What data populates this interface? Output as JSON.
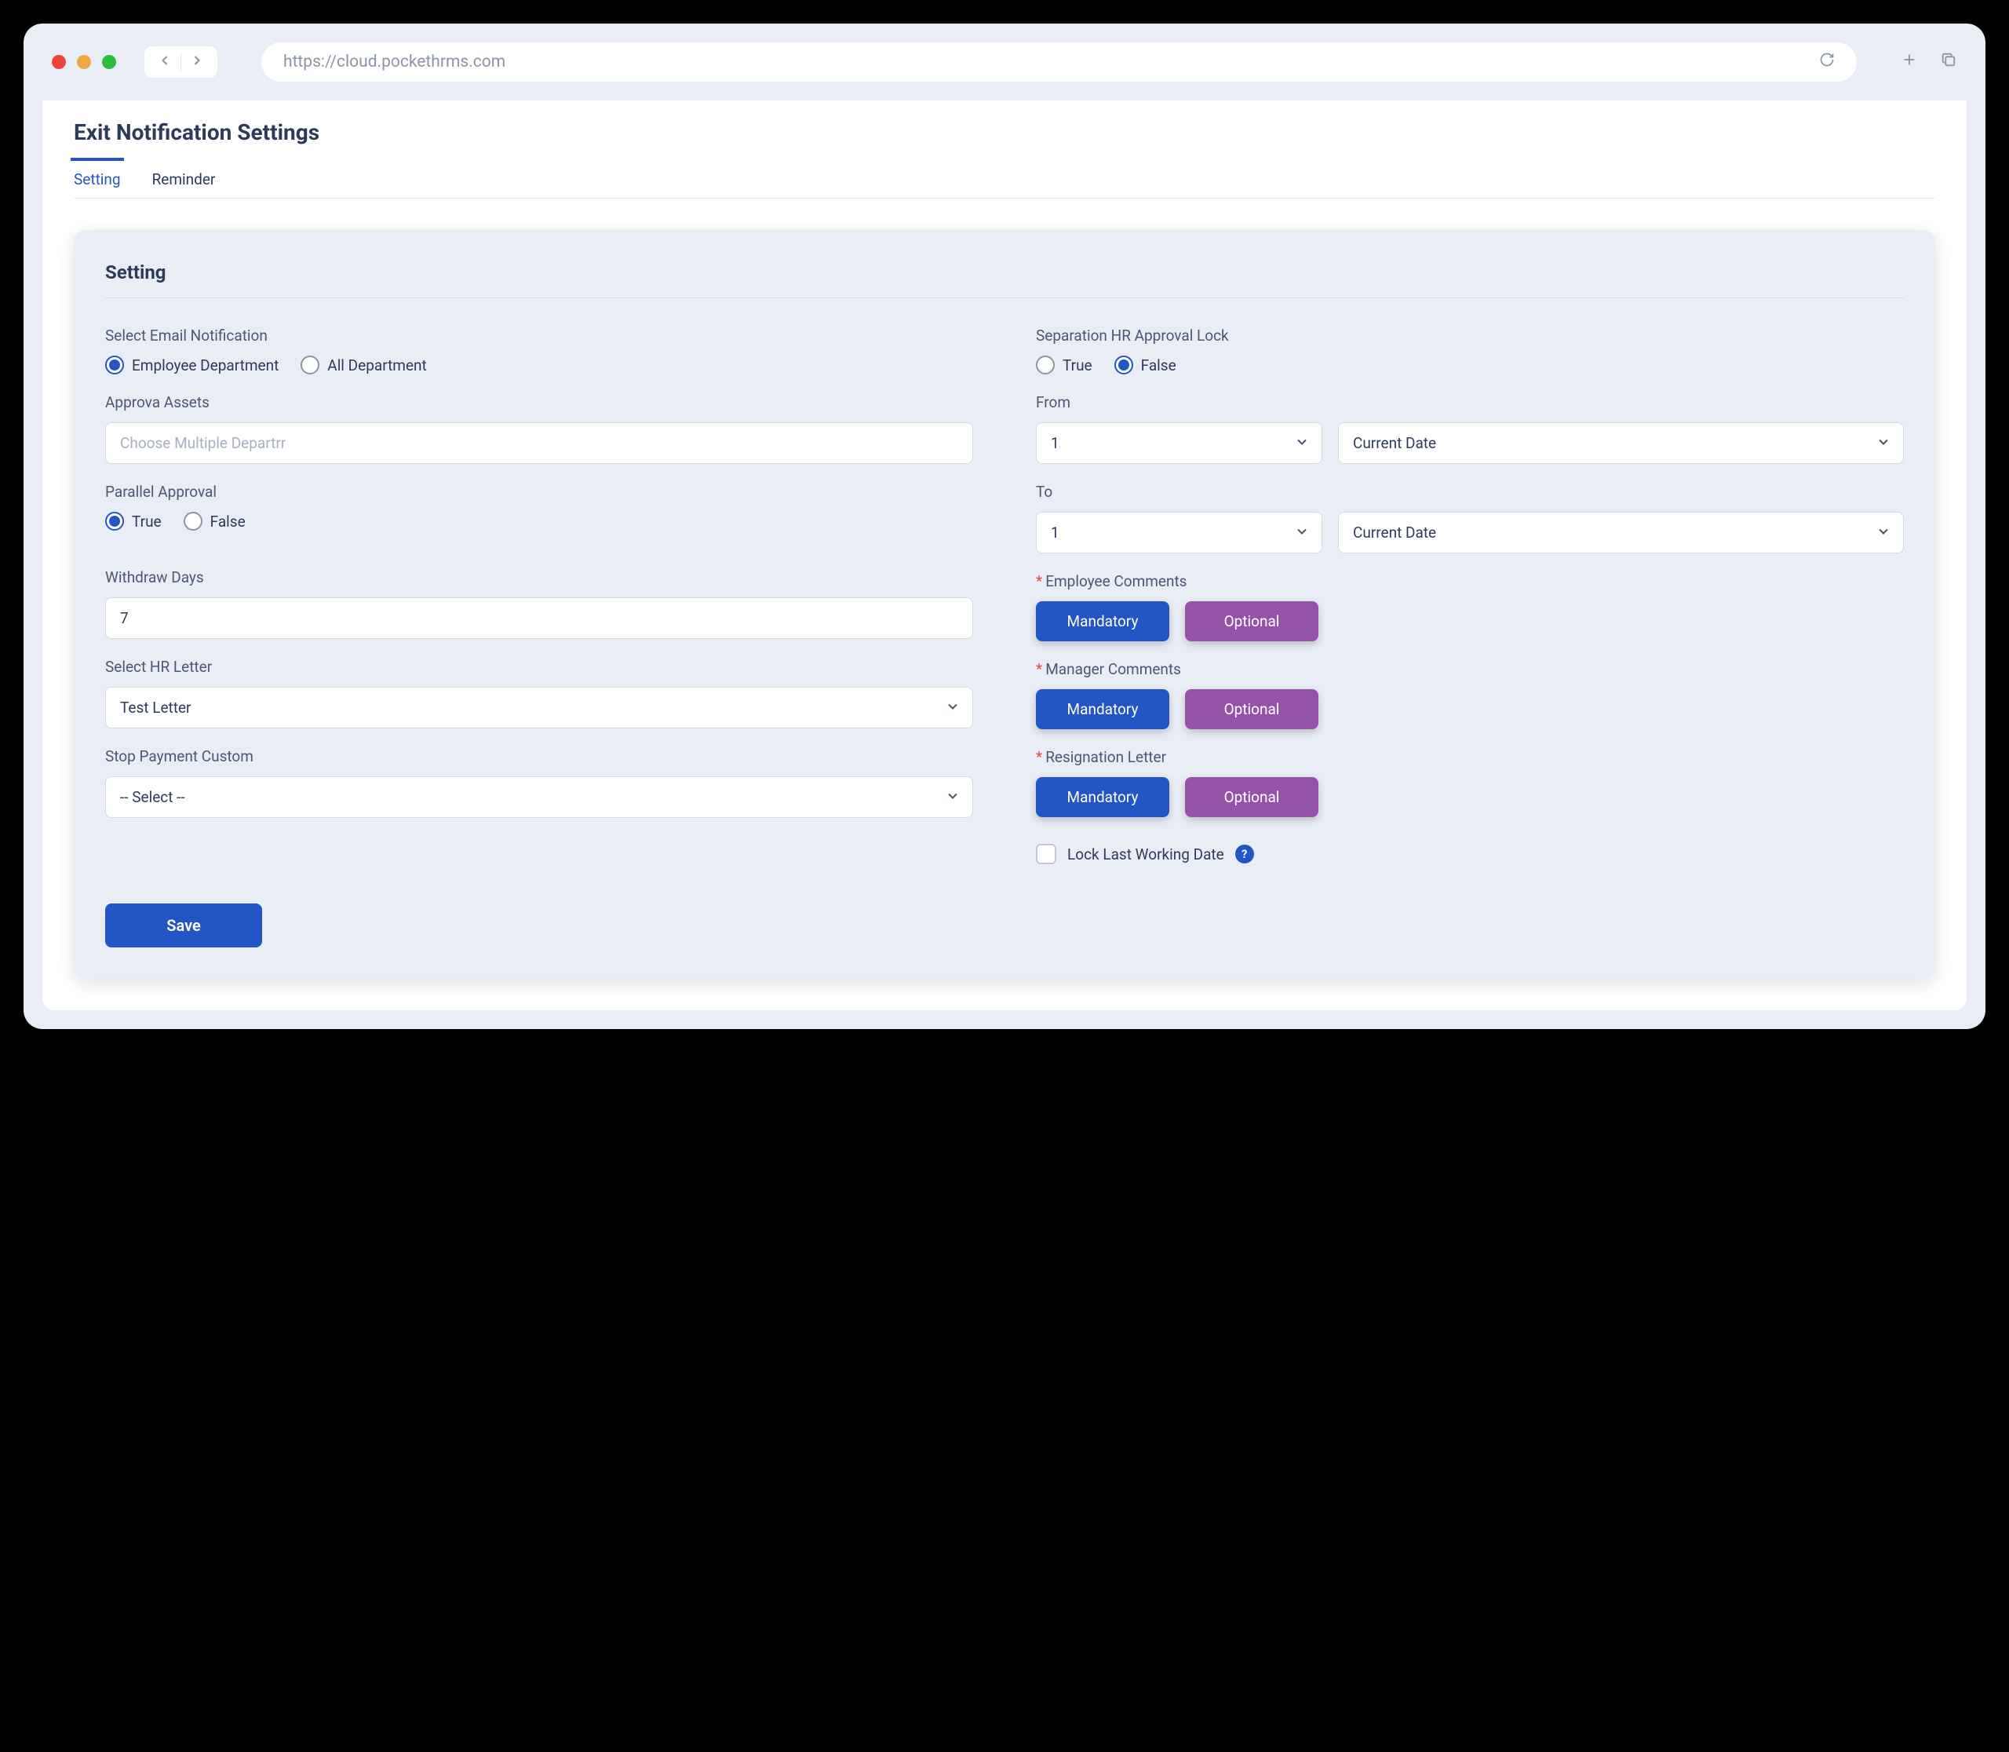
{
  "browser": {
    "url": "https://cloud.pockethrms.com"
  },
  "page": {
    "title": "Exit Notification Settings"
  },
  "tabs": {
    "setting": "Setting",
    "reminder": "Reminder"
  },
  "card": {
    "title": "Setting"
  },
  "left": {
    "emailNotification": {
      "label": "Select Email Notification",
      "opt1": "Employee Department",
      "opt2": "All Department"
    },
    "approvaAssets": {
      "label": "Approva Assets",
      "placeholder": "Choose Multiple Departrr"
    },
    "parallelApproval": {
      "label": "Parallel Approval",
      "opt1": "True",
      "opt2": "False"
    },
    "withdrawDays": {
      "label": "Withdraw Days",
      "value": "7"
    },
    "hrLetter": {
      "label": "Select HR Letter",
      "value": "Test Letter"
    },
    "stopPayment": {
      "label": "Stop Payment Custom",
      "value": "-- Select --"
    }
  },
  "right": {
    "approvalLock": {
      "label": "Separation HR Approval Lock",
      "opt1": "True",
      "opt2": "False"
    },
    "from": {
      "label": "From",
      "num": "1",
      "date": "Current Date"
    },
    "to": {
      "label": "To",
      "num": "1",
      "date": "Current Date"
    },
    "employeeComments": {
      "label": "Employee Comments",
      "mandatory": "Mandatory",
      "optional": "Optional"
    },
    "managerComments": {
      "label": "Manager Comments",
      "mandatory": "Mandatory",
      "optional": "Optional"
    },
    "resignationLetter": {
      "label": "Resignation Letter",
      "mandatory": "Mandatory",
      "optional": "Optional"
    },
    "lockLastWorking": {
      "label": "Lock Last Working Date"
    }
  },
  "actions": {
    "save": "Save"
  }
}
